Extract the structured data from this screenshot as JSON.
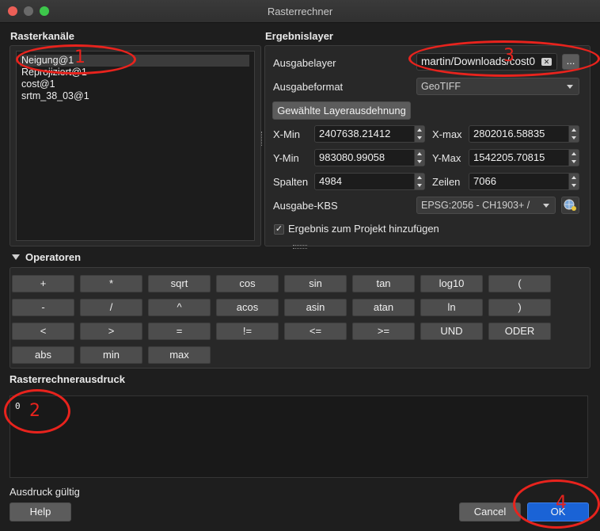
{
  "window": {
    "title": "Rasterrechner"
  },
  "raster_bands": {
    "heading": "Rasterkanäle",
    "items": [
      "Neigung@1",
      "Reprojiziert@1",
      "cost@1",
      "srtm_38_03@1"
    ]
  },
  "result_layer": {
    "heading": "Ergebnislayer",
    "output_layer_label": "Ausgabelayer",
    "output_layer_value": "martin/Downloads/cost0",
    "browse_label": "...",
    "output_format_label": "Ausgabeformat",
    "output_format_value": "GeoTIFF",
    "extent_button": "Gewählte Layerausdehnung",
    "xmin_label": "X-Min",
    "xmin_value": "2407638.21412",
    "xmax_label": "X-max",
    "xmax_value": "2802016.58835",
    "ymin_label": "Y-Min",
    "ymin_value": "983080.99058",
    "ymax_label": "Y-Max",
    "ymax_value": "1542205.70815",
    "columns_label": "Spalten",
    "columns_value": "4984",
    "rows_label": "Zeilen",
    "rows_value": "7066",
    "crs_label": "Ausgabe-KBS",
    "crs_value": "EPSG:2056 - CH1903+ /",
    "add_to_project_label": "Ergebnis zum Projekt hinzufügen",
    "add_to_project_checked": "✓"
  },
  "operators": {
    "heading": "Operatoren",
    "rows": [
      [
        "+",
        "*",
        "sqrt",
        "cos",
        "sin",
        "tan",
        "log10",
        "("
      ],
      [
        "-",
        "/",
        "^",
        "acos",
        "asin",
        "atan",
        "ln",
        ")"
      ],
      [
        "<",
        ">",
        "=",
        "!=",
        "<=",
        ">=",
        "UND",
        "ODER"
      ],
      [
        "abs",
        "min",
        "max"
      ]
    ]
  },
  "expression": {
    "heading": "Rasterrechnerausdruck",
    "value": "0",
    "status": "Ausdruck gültig"
  },
  "buttons": {
    "help": "Help",
    "cancel": "Cancel",
    "ok": "OK"
  },
  "annotations": {
    "n1": "1",
    "n2": "2",
    "n3": "3",
    "n4": "4"
  },
  "colors": {
    "annotation": "#e8231d",
    "ok_button": "#1a63d6"
  }
}
